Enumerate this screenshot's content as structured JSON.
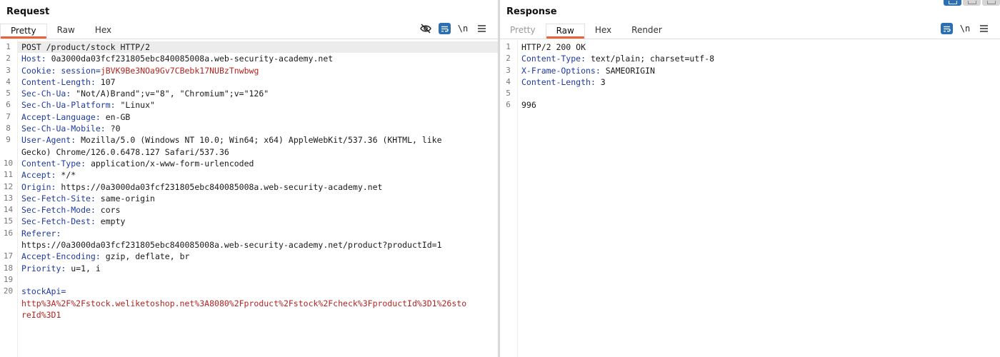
{
  "request": {
    "title": "Request",
    "tabs": [
      {
        "label": "Pretty",
        "active": true
      },
      {
        "label": "Raw",
        "active": false
      },
      {
        "label": "Hex",
        "active": false
      }
    ],
    "tools": {
      "newline_label": "\\n",
      "icons": [
        "eye-slash-icon",
        "wrap-text-icon",
        "newline-icon",
        "menu-icon"
      ]
    },
    "lines": [
      {
        "num": "1",
        "plain": "POST /product/stock HTTP/2"
      },
      {
        "num": "2",
        "name": "Host",
        "sep": ": ",
        "value": "0a3000da03fcf231805ebc840085008a.web-security-academy.net"
      },
      {
        "num": "3",
        "name": "Cookie",
        "sep": ": ",
        "cookie_name": "session",
        "cookie_eq": "=",
        "cookie_value": "jBVK9Be3NOa9Gv7CBebk17NUBzTnwbwg"
      },
      {
        "num": "4",
        "name": "Content-Length",
        "sep": ": ",
        "value": "107"
      },
      {
        "num": "5",
        "name": "Sec-Ch-Ua",
        "sep": ": ",
        "value": "\"Not/A)Brand\";v=\"8\", \"Chromium\";v=\"126\""
      },
      {
        "num": "6",
        "name": "Sec-Ch-Ua-Platform",
        "sep": ": ",
        "value": "\"Linux\""
      },
      {
        "num": "7",
        "name": "Accept-Language",
        "sep": ": ",
        "value": "en-GB"
      },
      {
        "num": "8",
        "name": "Sec-Ch-Ua-Mobile",
        "sep": ": ",
        "value": "?0"
      },
      {
        "num": "9",
        "name": "User-Agent",
        "sep": ": ",
        "value": "Mozilla/5.0 (Windows NT 10.0; Win64; x64) AppleWebKit/537.36 (KHTML, like",
        "cont": "Gecko) Chrome/126.0.6478.127 Safari/537.36"
      },
      {
        "num": "10",
        "name": "Content-Type",
        "sep": ": ",
        "value": "application/x-www-form-urlencoded"
      },
      {
        "num": "11",
        "name": "Accept",
        "sep": ": ",
        "value": "*/*"
      },
      {
        "num": "12",
        "name": "Origin",
        "sep": ": ",
        "value": "https://0a3000da03fcf231805ebc840085008a.web-security-academy.net"
      },
      {
        "num": "13",
        "name": "Sec-Fetch-Site",
        "sep": ": ",
        "value": "same-origin"
      },
      {
        "num": "14",
        "name": "Sec-Fetch-Mode",
        "sep": ": ",
        "value": "cors"
      },
      {
        "num": "15",
        "name": "Sec-Fetch-Dest",
        "sep": ": ",
        "value": "empty"
      },
      {
        "num": "16",
        "name": "Referer",
        "sep": ":",
        "value": "",
        "cont": "https://0a3000da03fcf231805ebc840085008a.web-security-academy.net/product?productId=1"
      },
      {
        "num": "17",
        "name": "Accept-Encoding",
        "sep": ": ",
        "value": "gzip, deflate, br"
      },
      {
        "num": "18",
        "name": "Priority",
        "sep": ": ",
        "value": "u=1, i"
      },
      {
        "num": "19",
        "plain": ""
      },
      {
        "num": "20",
        "param_name": "stockApi",
        "param_eq": "=",
        "param_value_1": "http%3A%2F%2Fstock.weliketoshop.net%3A8080%2Fproduct%2Fstock%2Fcheck%3FproductId%3D1%26sto",
        "param_value_2": "reId%3D1"
      }
    ]
  },
  "response": {
    "title": "Response",
    "tabs": [
      {
        "label": "Pretty",
        "active": false,
        "disabled": true
      },
      {
        "label": "Raw",
        "active": true
      },
      {
        "label": "Hex",
        "active": false
      },
      {
        "label": "Render",
        "active": false
      }
    ],
    "tools": {
      "newline_label": "\\n",
      "icons": [
        "wrap-text-icon",
        "newline-icon",
        "menu-icon"
      ]
    },
    "lines": [
      {
        "num": "1",
        "plain": "HTTP/2 200 OK"
      },
      {
        "num": "2",
        "name": "Content-Type",
        "sep": ": ",
        "value": "text/plain; charset=utf-8"
      },
      {
        "num": "3",
        "name": "X-Frame-Options",
        "sep": ": ",
        "value": "SAMEORIGIN"
      },
      {
        "num": "4",
        "name": "Content-Length",
        "sep": ": ",
        "value": "3"
      },
      {
        "num": "5",
        "plain": ""
      },
      {
        "num": "6",
        "plain": "996"
      }
    ]
  },
  "layout_buttons": [
    "side-by-side",
    "stacked",
    "single"
  ],
  "colors": {
    "accent": "#e8633c",
    "header_name": "#1f3ba1",
    "value_red": "#b22420",
    "button_blue": "#2d6fb3"
  }
}
